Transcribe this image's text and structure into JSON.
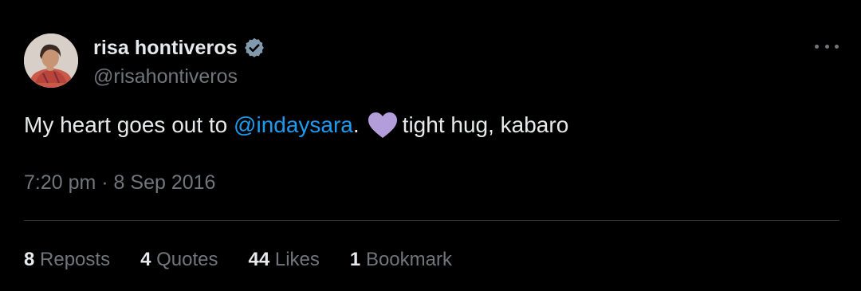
{
  "author": {
    "display_name": "risa hontiveros",
    "handle": "@risahontiveros",
    "verified": true,
    "verified_icon": "verified-badge-icon"
  },
  "menu_icon": "more-horizontal-icon",
  "tweet": {
    "text_before": "My heart goes out to ",
    "mention": "@indaysara",
    "text_mid": ".",
    "emoji": "purple-heart",
    "text_after": "tight hug, kabaro"
  },
  "timestamp": "7:20 pm · 8 Sep 2016",
  "stats": {
    "reposts_count": "8",
    "reposts_label": "Reposts",
    "quotes_count": "4",
    "quotes_label": "Quotes",
    "likes_count": "44",
    "likes_label": "Likes",
    "bookmarks_count": "1",
    "bookmarks_label": "Bookmark"
  },
  "colors": {
    "background": "#000000",
    "text_primary": "#e7e9ea",
    "text_secondary": "#71767b",
    "link": "#1d9bf0",
    "verified_badge": "#829aab",
    "heart": "#b39ddb",
    "divider": "#2f3336"
  }
}
